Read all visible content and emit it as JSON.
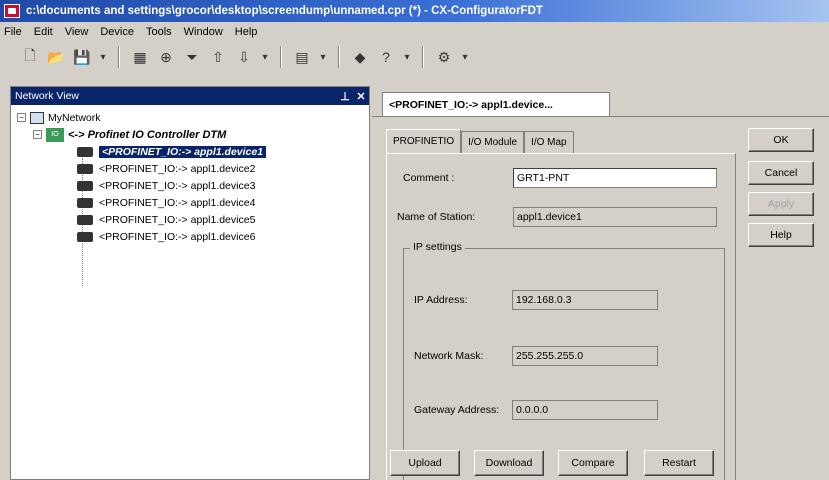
{
  "window": {
    "title": "c:\\documents and settings\\grocor\\desktop\\screendump\\unnamed.cpr (*) - CX-ConfiguratorFDT"
  },
  "menu": [
    "File",
    "Edit",
    "View",
    "Device",
    "Tools",
    "Window",
    "Help"
  ],
  "network_view": {
    "title": "Network View",
    "pin": "⊥",
    "close": "✕",
    "root": "MyNetwork",
    "controller": "<-> Profinet IO Controller DTM",
    "devices": [
      "<PROFINET_IO:-> appl1.device1",
      "<PROFINET_IO:-> appl1.device2",
      "<PROFINET_IO:-> appl1.device3",
      "<PROFINET_IO:-> appl1.device4",
      "<PROFINET_IO:-> appl1.device5",
      "<PROFINET_IO:-> appl1.device6"
    ]
  },
  "document_tab": "<PROFINET_IO:-> appl1.device...",
  "tabs": [
    "PROFINETIO",
    "I/O Module",
    "I/O Map"
  ],
  "form": {
    "comment_label": "Comment :",
    "comment_value": "GRT1-PNT",
    "station_label": "Name of Station:",
    "station_value": "appl1.device1",
    "ip_settings_label": "IP settings",
    "ip_label": "IP Address:",
    "ip_value": "192.168.0.3",
    "mask_label": "Network Mask:",
    "mask_value": "255.255.255.0",
    "gateway_label": "Gateway Address:",
    "gateway_value": "0.0.0.0"
  },
  "side_buttons": {
    "ok": "OK",
    "cancel": "Cancel",
    "apply": "Apply",
    "help": "Help"
  },
  "bottom_buttons": {
    "upload": "Upload",
    "download": "Download",
    "compare": "Compare",
    "restart": "Restart"
  },
  "colors": {
    "selection": "#0a246a",
    "title_start": "#1f4aa8",
    "title_end": "#a6c4f0"
  }
}
